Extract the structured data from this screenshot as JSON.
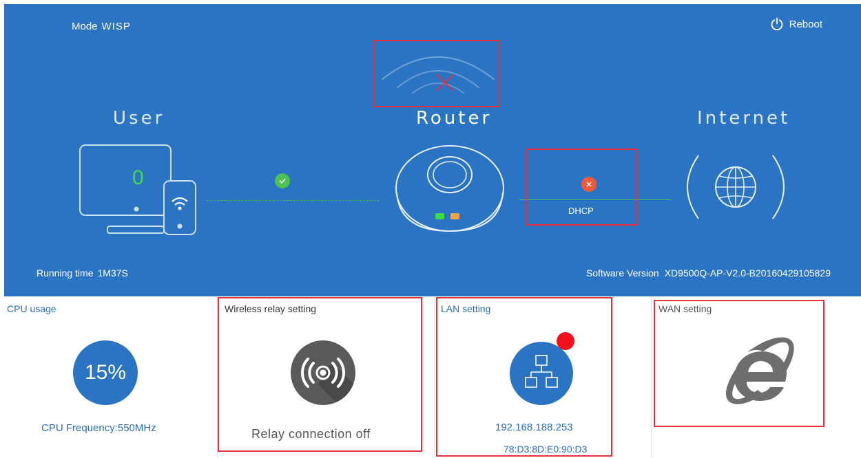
{
  "status": {
    "mode_label": "Mode",
    "mode_value": "WISP",
    "reboot_label": "Reboot",
    "user_label": "User",
    "router_label": "Router",
    "internet_label": "Internet",
    "connected_users": "0",
    "wan_protocol": "DHCP",
    "running_time_label": "Running time",
    "running_time_value": "1M37S",
    "software_version_label": "Software Version",
    "software_version_value": "XD9500Q-AP-V2.0-B20160429105829"
  },
  "panels": {
    "cpu": {
      "title": "CPU usage",
      "usage": "15%",
      "frequency": "CPU Frequency:550MHz"
    },
    "relay": {
      "title": "Wireless relay setting",
      "status": "Relay connection off"
    },
    "lan": {
      "title": "LAN setting",
      "ip": "192.168.188.253",
      "mac": "78:D3:8D:E0:90:D3"
    },
    "wan": {
      "title": "WAN setting"
    }
  },
  "icons": {
    "reboot": "power-icon",
    "wireless": "wifi-signal-icon",
    "user_ok": "check-circle-icon",
    "wan_error": "error-circle-icon",
    "internet": "globe-icon",
    "relay": "wireless-broadcast-icon",
    "lan": "network-topology-icon",
    "wan": "internet-explorer-icon"
  },
  "colors": {
    "header_bg": "#2b74c4",
    "highlight_box": "#e5323a",
    "ok": "#4cc251",
    "error": "#f05a3a",
    "link_text": "#2b6db4",
    "lan_alert": "#f2101c"
  }
}
